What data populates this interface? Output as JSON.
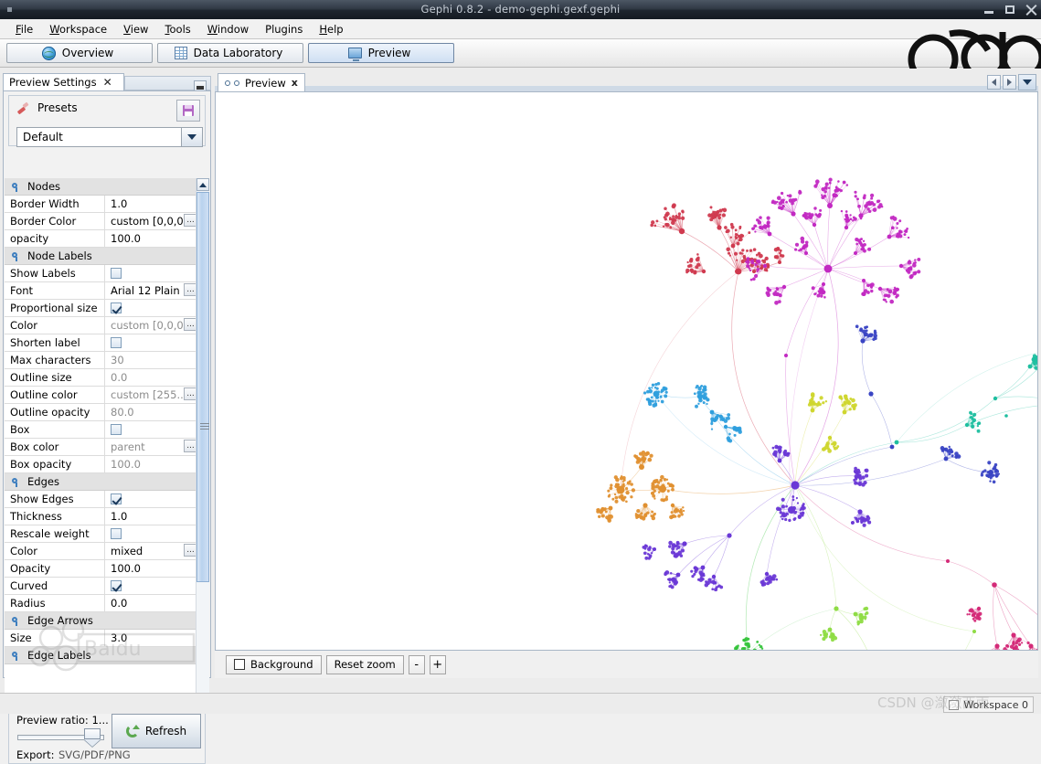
{
  "window": {
    "title": "Gephi 0.8.2 - demo-gephi.gexf.gephi",
    "minimize_label": "minimize-window",
    "maximize_label": "maximize-window",
    "close_label": "close-window"
  },
  "menubar": {
    "items": [
      {
        "label": "File",
        "mnemonic": "F"
      },
      {
        "label": "Workspace",
        "mnemonic": "W"
      },
      {
        "label": "View",
        "mnemonic": "V"
      },
      {
        "label": "Tools",
        "mnemonic": "T"
      },
      {
        "label": "Window",
        "mnemonic": "W"
      },
      {
        "label": "Plugins",
        "mnemonic": ""
      },
      {
        "label": "Help",
        "mnemonic": "H"
      }
    ]
  },
  "modebar": {
    "buttons": [
      {
        "label": "Overview",
        "icon": "globe-icon",
        "active": false
      },
      {
        "label": "Data Laboratory",
        "icon": "table-icon",
        "active": false
      },
      {
        "label": "Preview",
        "icon": "monitor-icon",
        "active": true
      }
    ]
  },
  "left_panel": {
    "tab_title": "Preview Settings",
    "close_label": "✕",
    "presets": {
      "title": "Presets",
      "selected": "Default",
      "save_tooltip": "Save preset"
    },
    "groups": [
      {
        "name": "Nodes",
        "rows": [
          {
            "name": "Border Width",
            "value": "1.0",
            "type": "text",
            "dim": false,
            "dots": false
          },
          {
            "name": "Border Color",
            "value": "custom [0,0,0]",
            "type": "text",
            "dim": false,
            "dots": true
          },
          {
            "name": "opacity",
            "value": "100.0",
            "type": "text",
            "dim": false,
            "dots": false
          }
        ]
      },
      {
        "name": "Node Labels",
        "rows": [
          {
            "name": "Show Labels",
            "value": "",
            "type": "checkbox",
            "checked": false,
            "dim": false,
            "dots": false
          },
          {
            "name": "Font",
            "value": "Arial 12 Plain",
            "type": "text",
            "dim": false,
            "dots": true
          },
          {
            "name": "Proportional size",
            "value": "",
            "type": "checkbox",
            "checked": true,
            "dim": false,
            "dots": false
          },
          {
            "name": "Color",
            "value": "custom [0,0,0]",
            "type": "text",
            "dim": true,
            "dots": true
          },
          {
            "name": "Shorten label",
            "value": "",
            "type": "checkbox",
            "checked": false,
            "dim": false,
            "dots": false
          },
          {
            "name": "Max characters",
            "value": "30",
            "type": "text",
            "dim": true,
            "dots": false
          },
          {
            "name": "Outline size",
            "value": "0.0",
            "type": "text",
            "dim": true,
            "dots": false
          },
          {
            "name": "Outline color",
            "value": "custom [255...",
            "type": "text",
            "dim": true,
            "dots": true
          },
          {
            "name": "Outline opacity",
            "value": "80.0",
            "type": "text",
            "dim": true,
            "dots": false
          },
          {
            "name": "Box",
            "value": "",
            "type": "checkbox",
            "checked": false,
            "dim": false,
            "dots": false
          },
          {
            "name": "Box color",
            "value": "parent",
            "type": "text",
            "dim": true,
            "dots": true
          },
          {
            "name": "Box opacity",
            "value": "100.0",
            "type": "text",
            "dim": true,
            "dots": false
          }
        ]
      },
      {
        "name": "Edges",
        "rows": [
          {
            "name": "Show Edges",
            "value": "",
            "type": "checkbox",
            "checked": true,
            "dim": false,
            "dots": false
          },
          {
            "name": "Thickness",
            "value": "1.0",
            "type": "text",
            "dim": false,
            "dots": false
          },
          {
            "name": "Rescale weight",
            "value": "",
            "type": "checkbox",
            "checked": false,
            "dim": false,
            "dots": false
          },
          {
            "name": "Color",
            "value": "mixed",
            "type": "text",
            "dim": false,
            "dots": true
          },
          {
            "name": "Opacity",
            "value": "100.0",
            "type": "text",
            "dim": false,
            "dots": false
          },
          {
            "name": "Curved",
            "value": "",
            "type": "checkbox",
            "checked": true,
            "dim": false,
            "dots": false
          },
          {
            "name": "Radius",
            "value": "0.0",
            "type": "text",
            "dim": false,
            "dots": false
          }
        ]
      },
      {
        "name": "Edge Arrows",
        "rows": [
          {
            "name": "Size",
            "value": "3.0",
            "type": "text",
            "dim": false,
            "dots": false
          }
        ]
      },
      {
        "name": "Edge Labels",
        "rows": []
      }
    ],
    "footer": {
      "ratio_label": "Preview ratio: 1...",
      "export_label": "Export:",
      "export_value": "SVG/PDF/PNG",
      "refresh_label": "Refresh"
    }
  },
  "preview": {
    "tab_label": "Preview",
    "tab_icon": "glasses-icon",
    "tab_close": "x",
    "nav_prev": "prev-tab",
    "nav_next": "next-tab",
    "nav_list": "tab-list",
    "controls": {
      "background_label": "Background",
      "background_checked": false,
      "reset_zoom_label": "Reset zoom",
      "zoom_out_label": "-",
      "zoom_in_label": "+"
    }
  },
  "statusbar": {
    "workspace_label": "Workspace 0",
    "workspace_checked": false
  },
  "graph": {
    "description": "Force-directed network of radial hub-and-spoke clusters, colored by modularity class",
    "cluster_colors": {
      "crimson": "#d03a4f",
      "magenta": "#c229c2",
      "orchid": "#b84fd0",
      "pink": "#d42a78",
      "azure": "#2f9fdd",
      "teal": "#1fbfa0",
      "olive": "#cfd62e",
      "orange": "#e09030",
      "violet": "#6a38d6",
      "indigo": "#3a45c4",
      "green": "#35c43b",
      "lime": "#8fdc45"
    }
  },
  "watermarks": {
    "baidu": "Baidu 百科",
    "csdn": "CSDN @潾潾西雨"
  }
}
